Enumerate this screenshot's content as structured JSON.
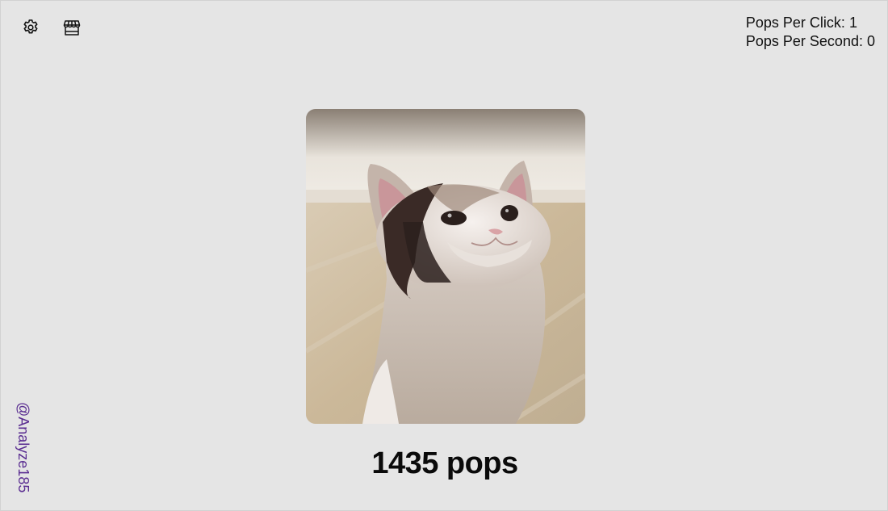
{
  "toolbar": {
    "settings_icon": "gear-icon",
    "shop_icon": "storefront-icon"
  },
  "stats": {
    "per_click_label": "Pops Per Click:",
    "per_click_value": "1",
    "per_second_label": "Pops Per Second:",
    "per_second_value": "0"
  },
  "main": {
    "image_subject": "pop cat",
    "count": "1435",
    "count_unit": "pops"
  },
  "footer": {
    "credit": "@Analyze185"
  },
  "colors": {
    "background": "#e5e5e5",
    "text": "#111111",
    "credit": "#5a2d91"
  }
}
